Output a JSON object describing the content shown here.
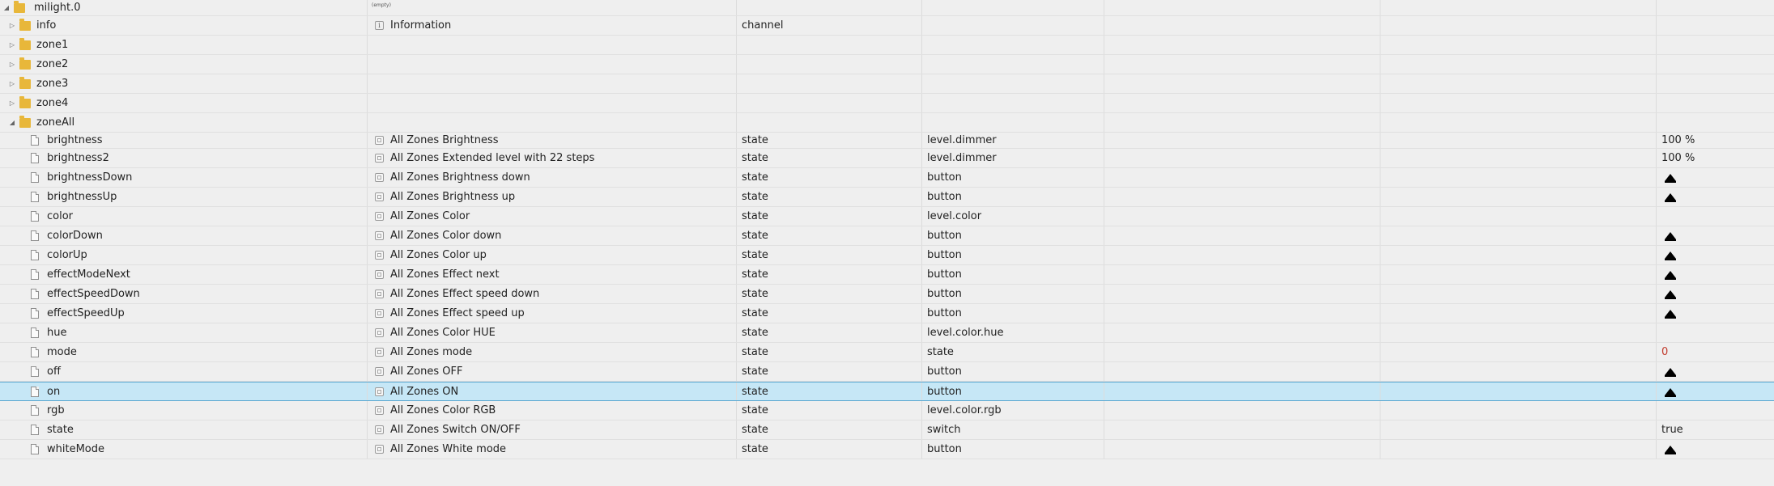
{
  "root": {
    "id": "milight.0",
    "name": "(empty)"
  },
  "folders": [
    {
      "id": "info",
      "name": "Information",
      "type": "channel",
      "expanded": false
    },
    {
      "id": "zone1",
      "expanded": false
    },
    {
      "id": "zone2",
      "expanded": false
    },
    {
      "id": "zone3",
      "expanded": false
    },
    {
      "id": "zone4",
      "expanded": false
    },
    {
      "id": "zoneAll",
      "expanded": true
    }
  ],
  "states": [
    {
      "id": "brightness",
      "name": "All Zones Brightness",
      "type": "state",
      "role": "level.dimmer",
      "value": "100 %"
    },
    {
      "id": "brightness2",
      "name": "All Zones Extended level with 22 steps",
      "type": "state",
      "role": "level.dimmer",
      "value": "100 %"
    },
    {
      "id": "brightnessDown",
      "name": "All Zones Brightness down",
      "type": "state",
      "role": "button",
      "value_icon": "button-icon"
    },
    {
      "id": "brightnessUp",
      "name": "All Zones Brightness up",
      "type": "state",
      "role": "button",
      "value_icon": "button-icon"
    },
    {
      "id": "color",
      "name": "All Zones Color",
      "type": "state",
      "role": "level.color"
    },
    {
      "id": "colorDown",
      "name": "All Zones Color down",
      "type": "state",
      "role": "button",
      "value_icon": "button-icon"
    },
    {
      "id": "colorUp",
      "name": "All Zones Color up",
      "type": "state",
      "role": "button",
      "value_icon": "button-icon"
    },
    {
      "id": "effectModeNext",
      "name": "All Zones Effect next",
      "type": "state",
      "role": "button",
      "value_icon": "button-icon"
    },
    {
      "id": "effectSpeedDown",
      "name": "All Zones Effect speed down",
      "type": "state",
      "role": "button",
      "value_icon": "button-icon"
    },
    {
      "id": "effectSpeedUp",
      "name": "All Zones Effect speed up",
      "type": "state",
      "role": "button",
      "value_icon": "button-icon"
    },
    {
      "id": "hue",
      "name": "All Zones Color HUE",
      "type": "state",
      "role": "level.color.hue"
    },
    {
      "id": "mode",
      "name": "All Zones mode",
      "type": "state",
      "role": "state",
      "value": "0",
      "value_color": "#c0392b"
    },
    {
      "id": "off",
      "name": "All Zones OFF",
      "type": "state",
      "role": "button",
      "value_icon": "button-icon"
    },
    {
      "id": "on",
      "name": "All Zones ON",
      "type": "state",
      "role": "button",
      "value_icon": "button-icon",
      "selected": true
    },
    {
      "id": "rgb",
      "name": "All Zones Color RGB",
      "type": "state",
      "role": "level.color.rgb"
    },
    {
      "id": "state",
      "name": "All Zones Switch ON/OFF",
      "type": "state",
      "role": "switch",
      "value": "true"
    },
    {
      "id": "whiteMode",
      "name": "All Zones White mode",
      "type": "state",
      "role": "button",
      "value_icon": "button-icon"
    }
  ],
  "colors": {
    "selected_bg": "#c6e7f6",
    "selected_border": "#5aa7d0",
    "folder": "#e8b73a"
  },
  "icons": {
    "folder": "folder-icon",
    "state": "file-icon",
    "expanded": "chevron-down-icon",
    "collapsed": "chevron-right-icon"
  }
}
